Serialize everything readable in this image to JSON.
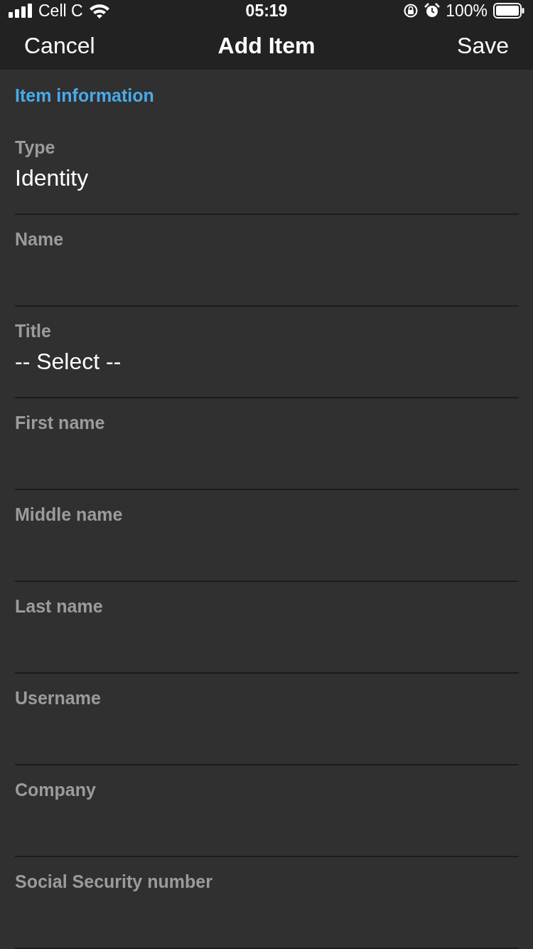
{
  "status_bar": {
    "carrier": "Cell C",
    "time": "05:19",
    "battery": "100%"
  },
  "nav_bar": {
    "cancel": "Cancel",
    "title": "Add Item",
    "save": "Save"
  },
  "section": {
    "title": "Item information"
  },
  "fields": [
    {
      "label": "Type",
      "kind": "select",
      "value": "Identity"
    },
    {
      "label": "Name",
      "kind": "text"
    },
    {
      "label": "Title",
      "kind": "select",
      "value": "-- Select --"
    },
    {
      "label": "First name",
      "kind": "text"
    },
    {
      "label": "Middle name",
      "kind": "text"
    },
    {
      "label": "Last name",
      "kind": "text"
    },
    {
      "label": "Username",
      "kind": "text"
    },
    {
      "label": "Company",
      "kind": "text"
    },
    {
      "label": "Social Security number",
      "kind": "text"
    }
  ]
}
